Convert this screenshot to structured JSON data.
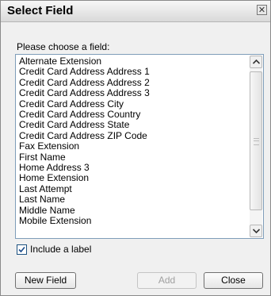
{
  "dialog": {
    "title": "Select Field",
    "close_icon_glyph": "✕"
  },
  "prompt": "Please choose a field:",
  "list": {
    "items": [
      "Alternate Extension",
      "Credit Card Address Address 1",
      "Credit Card Address Address 2",
      "Credit Card Address Address 3",
      "Credit Card Address City",
      "Credit Card Address Country",
      "Credit Card Address State",
      "Credit Card Address ZIP Code",
      "Fax Extension",
      "First Name",
      "Home Address 3",
      "Home Extension",
      "Last Attempt",
      "Last Name",
      "Middle Name",
      "Mobile Extension"
    ]
  },
  "checkbox": {
    "label": "Include a label",
    "checked": true
  },
  "buttons": {
    "new_field": "New Field",
    "add": "Add",
    "close": "Close"
  }
}
